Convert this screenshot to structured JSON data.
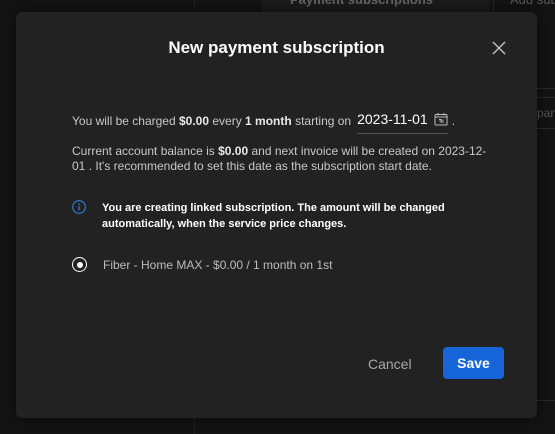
{
  "background": {
    "tab_payment_subscriptions": "Payment subscriptions",
    "tab_add_sub": "Add sub",
    "side_box_fragment": "pane"
  },
  "modal": {
    "title": "New payment subscription",
    "charge": {
      "prefix": "You will be charged",
      "amount": "$0.00",
      "every": "every",
      "period": "1 month",
      "starting_on": "starting on",
      "start_date": "2023-11-01",
      "suffix": "."
    },
    "balance": {
      "prefix": "Current account balance is",
      "amount": "$0.00",
      "middle": "and next invoice will be created on",
      "next_invoice_date": "2023-12-01",
      "suffix": ". It's recommended to set this date as the subscription start date."
    },
    "info_message": "You are creating linked subscription. The amount will be changed automatically, when the service price changes.",
    "service_option": {
      "label": "Fiber - Home MAX - $0.00 / 1 month on 1st",
      "selected": true
    },
    "cancel_label": "Cancel",
    "save_label": "Save"
  },
  "colors": {
    "accent": "#1565d8",
    "info_icon": "#2f7fe0",
    "modal_bg": "#222222"
  }
}
